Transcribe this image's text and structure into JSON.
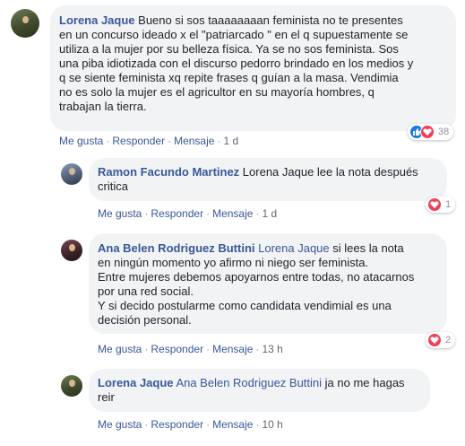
{
  "comments": [
    {
      "author": "Lorena Jaque",
      "lines": [
        " Bueno si sos taaaaaaaan feminista no te presentes",
        "en un concurso ideado x el \"patriarcado \" en el q supuestamente se",
        "utiliza a la mujer por su belleza física. Ya se no sos feminista. Sos",
        "una piba idiotizada con el discurso pedorro brindado en los medios y",
        "q se siente feminista xq repite frases q guían a la masa. Vendimia",
        "no es solo la mujer es el agricultor en su mayoría hombres, q",
        "trabajan la tierra."
      ],
      "actions": {
        "like": "Me gusta",
        "reply": "Responder",
        "message": "Mensaje",
        "time": "1 d"
      },
      "reaction_count": "38",
      "reaction_icons": [
        "like-icon",
        "love-icon"
      ]
    },
    {
      "author": "Ramon Facundo Martinez",
      "line1_rest": " Lorena Jaque lee la nota después",
      "line2": "critica",
      "actions": {
        "like": "Me gusta",
        "reply": "Responder",
        "message": "Mensaje",
        "time": "1 d"
      },
      "reaction_count": "1",
      "reaction_icons": [
        "love-icon"
      ]
    },
    {
      "author": "Ana Belen Rodriguez Buttini",
      "mention": "Lorena Jaque",
      "line1_rest": " si lees la nota",
      "lines": [
        "en ningún momento yo afirmo ni niego ser feminista.",
        "Entre mujeres debemos apoyarnos entre todas, no atacarnos",
        "por una red social.",
        "Y si decido postularme como candidata vendimial es una",
        "decisión personal."
      ],
      "actions": {
        "like": "Me gusta",
        "reply": "Responder",
        "message": "Mensaje",
        "time": "13 h"
      },
      "reaction_count": "2",
      "reaction_icons": [
        "love-icon"
      ]
    },
    {
      "author": "Lorena Jaque",
      "mention": "Ana Belen Rodriguez Buttini",
      "line1_rest": " ja no me hagas",
      "line2": "reir",
      "actions": {
        "like": "Me gusta",
        "reply": "Responder",
        "message": "Mensaje",
        "time": "10 h"
      }
    }
  ],
  "colors": {
    "link": "#385898",
    "bubble": "#f2f3f5",
    "love": "#f33e58",
    "like": "#1877f2"
  }
}
